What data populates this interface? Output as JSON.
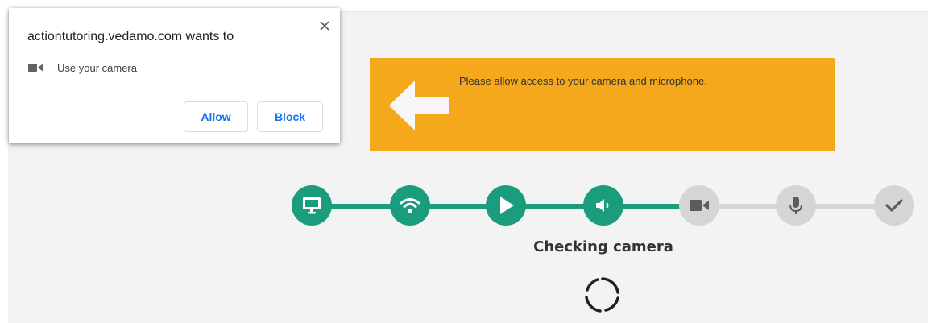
{
  "permission_popup": {
    "title": "actiontutoring.vedamo.com wants to",
    "permission_icon": "camera-icon",
    "permission_label": "Use your camera",
    "allow_label": "Allow",
    "block_label": "Block",
    "close_icon": "close-icon"
  },
  "banner": {
    "message": "Please allow access to your camera and microphone.",
    "icon": "arrow-left-icon",
    "color": "#f6a81c"
  },
  "steps": {
    "items": [
      {
        "name": "screen",
        "icon": "monitor-icon",
        "state": "done"
      },
      {
        "name": "network",
        "icon": "wifi-icon",
        "state": "done"
      },
      {
        "name": "playback",
        "icon": "play-icon",
        "state": "done"
      },
      {
        "name": "speaker",
        "icon": "speaker-icon",
        "state": "done"
      },
      {
        "name": "camera",
        "icon": "camera-icon",
        "state": "pending"
      },
      {
        "name": "microphone",
        "icon": "microphone-icon",
        "state": "pending"
      },
      {
        "name": "complete",
        "icon": "checkmark-icon",
        "state": "pending"
      }
    ],
    "done_color": "#1a9c7d",
    "pending_color": "#d5d5d5",
    "status_text": "Checking camera"
  },
  "spinner_icon": "loading-spinner-icon"
}
